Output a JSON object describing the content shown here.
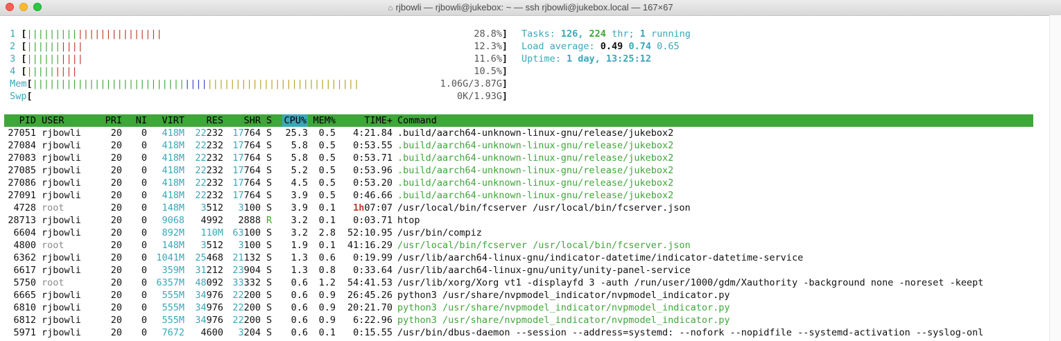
{
  "window": {
    "title": "rjbowli — rjbowli@jukebox: ~ — ssh rjbowli@jukebox.local — 167×67"
  },
  "meters": {
    "cpu": [
      {
        "label": "1",
        "green": 9,
        "red": 15,
        "blue": 0,
        "value": "28.8%"
      },
      {
        "label": "2",
        "green": 6,
        "red": 4,
        "blue": 0,
        "value": "12.3%"
      },
      {
        "label": "3",
        "green": 6,
        "red": 4,
        "blue": 0,
        "value": "11.6%"
      },
      {
        "label": "4",
        "green": 5,
        "red": 4,
        "blue": 0,
        "value": "10.5%"
      }
    ],
    "mem": {
      "label": "Mem",
      "green": 27,
      "blue": 4,
      "yellow": 27,
      "value": "1.06G/3.87G"
    },
    "swp": {
      "label": "Swp",
      "value": "0K/1.93G"
    }
  },
  "stats": {
    "tasks_label": "Tasks:",
    "tasks": "126,",
    "threads": "224",
    "thr_label": "thr;",
    "running": "1",
    "running_label": "running",
    "load_label": "Load average:",
    "load1": "0.49",
    "load5": "0.74",
    "load15": "0.65",
    "uptime_label": "Uptime:",
    "uptime": "1 day, 13:25:12"
  },
  "columns": {
    "pid": "PID",
    "user": "USER",
    "pri": "PRI",
    "ni": "NI",
    "virt": "VIRT",
    "res": "RES",
    "shr": "SHR",
    "s": "S",
    "cpu": "CPU%",
    "mem": "MEM%",
    "time": "TIME+",
    "command": "Command"
  },
  "processes": [
    {
      "pid": "27051",
      "user": "rjbowli",
      "pri": "20",
      "ni": "0",
      "virt": "418M",
      "res_a": "22",
      "res_b": "232",
      "shr_a": "17",
      "shr_b": "764",
      "s": "S",
      "cpu": "25.3",
      "mem": "0.5",
      "time_h": "",
      "time": "4:21.84",
      "cmd": ".build/aarch64-unknown-linux-gnu/release/jukebox2",
      "thread": false,
      "root": false
    },
    {
      "pid": "27084",
      "user": "rjbowli",
      "pri": "20",
      "ni": "0",
      "virt": "418M",
      "res_a": "22",
      "res_b": "232",
      "shr_a": "17",
      "shr_b": "764",
      "s": "S",
      "cpu": "5.8",
      "mem": "0.5",
      "time_h": "",
      "time": "0:53.55",
      "cmd": ".build/aarch64-unknown-linux-gnu/release/jukebox2",
      "thread": true,
      "root": false
    },
    {
      "pid": "27083",
      "user": "rjbowli",
      "pri": "20",
      "ni": "0",
      "virt": "418M",
      "res_a": "22",
      "res_b": "232",
      "shr_a": "17",
      "shr_b": "764",
      "s": "S",
      "cpu": "5.8",
      "mem": "0.5",
      "time_h": "",
      "time": "0:53.71",
      "cmd": ".build/aarch64-unknown-linux-gnu/release/jukebox2",
      "thread": true,
      "root": false
    },
    {
      "pid": "27085",
      "user": "rjbowli",
      "pri": "20",
      "ni": "0",
      "virt": "418M",
      "res_a": "22",
      "res_b": "232",
      "shr_a": "17",
      "shr_b": "764",
      "s": "S",
      "cpu": "5.2",
      "mem": "0.5",
      "time_h": "",
      "time": "0:53.96",
      "cmd": ".build/aarch64-unknown-linux-gnu/release/jukebox2",
      "thread": true,
      "root": false
    },
    {
      "pid": "27086",
      "user": "rjbowli",
      "pri": "20",
      "ni": "0",
      "virt": "418M",
      "res_a": "22",
      "res_b": "232",
      "shr_a": "17",
      "shr_b": "764",
      "s": "S",
      "cpu": "4.5",
      "mem": "0.5",
      "time_h": "",
      "time": "0:53.20",
      "cmd": ".build/aarch64-unknown-linux-gnu/release/jukebox2",
      "thread": true,
      "root": false
    },
    {
      "pid": "27091",
      "user": "rjbowli",
      "pri": "20",
      "ni": "0",
      "virt": "418M",
      "res_a": "22",
      "res_b": "232",
      "shr_a": "17",
      "shr_b": "764",
      "s": "S",
      "cpu": "3.9",
      "mem": "0.5",
      "time_h": "",
      "time": "0:46.66",
      "cmd": ".build/aarch64-unknown-linux-gnu/release/jukebox2",
      "thread": true,
      "root": false
    },
    {
      "pid": "4728",
      "user": "root",
      "pri": "20",
      "ni": "0",
      "virt": "148M",
      "res_a": "3",
      "res_b": "512",
      "shr_a": "3",
      "shr_b": "100",
      "s": "S",
      "cpu": "3.9",
      "mem": "0.1",
      "time_h": "1h",
      "time": "07:07",
      "cmd": "/usr/local/bin/fcserver /usr/local/bin/fcserver.json",
      "thread": false,
      "root": true
    },
    {
      "pid": "28713",
      "user": "rjbowli",
      "pri": "20",
      "ni": "0",
      "virt": "9068",
      "res_a": "",
      "res_b": "4992",
      "shr_a": "",
      "shr_b": "2888",
      "s": "R",
      "cpu": "3.2",
      "mem": "0.1",
      "time_h": "",
      "time": "0:03.71",
      "cmd": "htop",
      "thread": false,
      "root": false
    },
    {
      "pid": "6604",
      "user": "rjbowli",
      "pri": "20",
      "ni": "0",
      "virt": "892M",
      "res_a": "110M",
      "res_b": "",
      "shr_a": "63",
      "shr_b": "100",
      "s": "S",
      "cpu": "3.2",
      "mem": "2.8",
      "time_h": "",
      "time": "52:10.95",
      "cmd": "/usr/bin/compiz",
      "thread": false,
      "root": false
    },
    {
      "pid": "4800",
      "user": "root",
      "pri": "20",
      "ni": "0",
      "virt": "148M",
      "res_a": "3",
      "res_b": "512",
      "shr_a": "3",
      "shr_b": "100",
      "s": "S",
      "cpu": "1.9",
      "mem": "0.1",
      "time_h": "",
      "time": "41:16.29",
      "cmd": "/usr/local/bin/fcserver /usr/local/bin/fcserver.json",
      "thread": true,
      "root": true
    },
    {
      "pid": "6362",
      "user": "rjbowli",
      "pri": "20",
      "ni": "0",
      "virt": "1041M",
      "res_a": "25",
      "res_b": "468",
      "shr_a": "21",
      "shr_b": "132",
      "s": "S",
      "cpu": "1.3",
      "mem": "0.6",
      "time_h": "",
      "time": "0:19.99",
      "cmd": "/usr/lib/aarch64-linux-gnu/indicator-datetime/indicator-datetime-service",
      "thread": false,
      "root": false
    },
    {
      "pid": "6617",
      "user": "rjbowli",
      "pri": "20",
      "ni": "0",
      "virt": "359M",
      "res_a": "31",
      "res_b": "212",
      "shr_a": "23",
      "shr_b": "904",
      "s": "S",
      "cpu": "1.3",
      "mem": "0.8",
      "time_h": "",
      "time": "0:33.64",
      "cmd": "/usr/lib/aarch64-linux-gnu/unity/unity-panel-service",
      "thread": false,
      "root": false
    },
    {
      "pid": "5750",
      "user": "root",
      "pri": "20",
      "ni": "0",
      "virt": "6357M",
      "res_a": "48",
      "res_b": "092",
      "shr_a": "33",
      "shr_b": "332",
      "s": "S",
      "cpu": "0.6",
      "mem": "1.2",
      "time_h": "",
      "time": "54:41.53",
      "cmd": "/usr/lib/xorg/Xorg vt1 -displayfd 3 -auth /run/user/1000/gdm/Xauthority -background none -noreset -keept",
      "thread": false,
      "root": true
    },
    {
      "pid": "6665",
      "user": "rjbowli",
      "pri": "20",
      "ni": "0",
      "virt": "555M",
      "res_a": "34",
      "res_b": "976",
      "shr_a": "22",
      "shr_b": "200",
      "s": "S",
      "cpu": "0.6",
      "mem": "0.9",
      "time_h": "",
      "time": "26:45.26",
      "cmd": "python3 /usr/share/nvpmodel_indicator/nvpmodel_indicator.py",
      "thread": false,
      "root": false
    },
    {
      "pid": "6810",
      "user": "rjbowli",
      "pri": "20",
      "ni": "0",
      "virt": "555M",
      "res_a": "34",
      "res_b": "976",
      "shr_a": "22",
      "shr_b": "200",
      "s": "S",
      "cpu": "0.6",
      "mem": "0.9",
      "time_h": "",
      "time": "20:21.70",
      "cmd": "python3 /usr/share/nvpmodel_indicator/nvpmodel_indicator.py",
      "thread": true,
      "root": false
    },
    {
      "pid": "6812",
      "user": "rjbowli",
      "pri": "20",
      "ni": "0",
      "virt": "555M",
      "res_a": "34",
      "res_b": "976",
      "shr_a": "22",
      "shr_b": "200",
      "s": "S",
      "cpu": "0.6",
      "mem": "0.9",
      "time_h": "",
      "time": "6:22.96",
      "cmd": "python3 /usr/share/nvpmodel_indicator/nvpmodel_indicator.py",
      "thread": true,
      "root": false
    },
    {
      "pid": "5971",
      "user": "rjbowli",
      "pri": "20",
      "ni": "0",
      "virt": "7672",
      "res_a": "",
      "res_b": "4600",
      "shr_a": "3",
      "shr_b": "204",
      "s": "S",
      "cpu": "0.6",
      "mem": "0.1",
      "time_h": "",
      "time": "0:15.55",
      "cmd": "/usr/bin/dbus-daemon --session --address=systemd: --nofork --nopidfile --systemd-activation --syslog-onl",
      "thread": false,
      "root": false
    }
  ]
}
